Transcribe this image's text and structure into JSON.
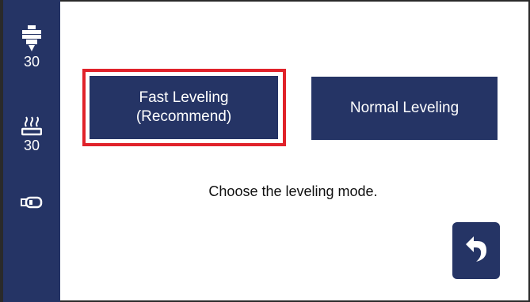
{
  "sidebar": {
    "nozzle": {
      "icon": "nozzle-icon",
      "value": "30"
    },
    "bed": {
      "icon": "heated-bed-icon",
      "value": "30"
    },
    "storage": {
      "icon": "usb-drive-icon"
    }
  },
  "main": {
    "fast_leveling": {
      "line1": "Fast Leveling",
      "line2": "(Recommend)"
    },
    "normal_leveling": {
      "label": "Normal Leveling"
    },
    "instruction": "Choose the leveling mode.",
    "back": {
      "icon": "back-arrow-icon"
    }
  },
  "colors": {
    "sidebar": "#253465",
    "button": "#253465",
    "highlight": "#e0222a",
    "background": "#ffffff"
  }
}
